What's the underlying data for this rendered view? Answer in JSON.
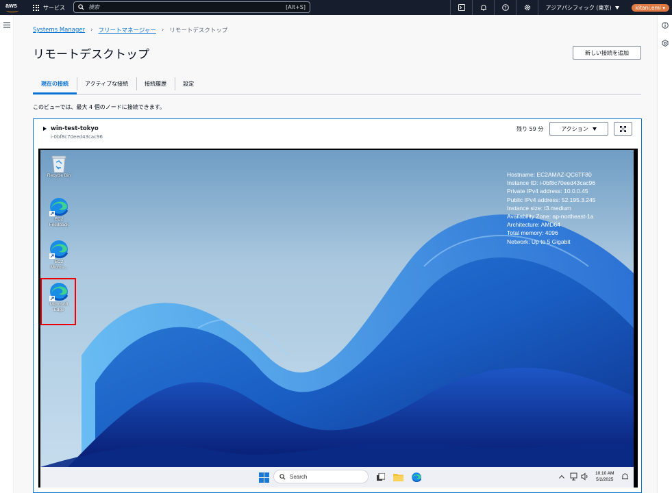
{
  "topnav": {
    "logo": "aws",
    "services_label": "サービス",
    "search_placeholder": "検索",
    "search_shortcut": "[Alt+S]",
    "region": "アジアパシフィック (東京)",
    "user": "kitani.emi"
  },
  "breadcrumb": {
    "item1": "Systems Manager",
    "item2": "フリートマネージャー",
    "current": "リモートデスクトップ"
  },
  "page": {
    "title": "リモートデスクトップ",
    "add_button": "新しい接続を追加",
    "note": "このビューでは、最大 4 個のノードに接続できます。"
  },
  "tabs": [
    {
      "label": "現在の接続",
      "active": true
    },
    {
      "label": "アクティブな接続",
      "active": false
    },
    {
      "label": "接続履歴",
      "active": false
    },
    {
      "label": "設定",
      "active": false
    }
  ],
  "session": {
    "node_name": "win-test-tokyo",
    "node_id": "i-0bf8c70eed43cac96",
    "remaining": "残り 59 分",
    "action_button": "アクション"
  },
  "desktop": {
    "sysinfo": [
      "Hostname: EC2AMAZ-QC6TF80",
      "Instance ID: i-0bf8c70eed43cac96",
      "Private IPv4 address: 10.0.0.45",
      "Public IPv4 address: 52.195.3.245",
      "Instance size: t3.medium",
      "Availability Zone: ap-northeast-1a",
      "Architecture: AMD64",
      "Total memory: 4096",
      "Network: Up to 5 Gigabit"
    ],
    "icons": {
      "recycle": "Recycle Bin",
      "ec2_feedback_1": "EC2",
      "ec2_feedback_2": "Feedback",
      "ec2_micro_1": "EC2",
      "ec2_micro_2": "Micros...",
      "edge_1": "Microsoft",
      "edge_2": "Edge"
    },
    "taskbar": {
      "search": "Search",
      "time": "10:10 AM",
      "date": "5/2/2025"
    }
  }
}
